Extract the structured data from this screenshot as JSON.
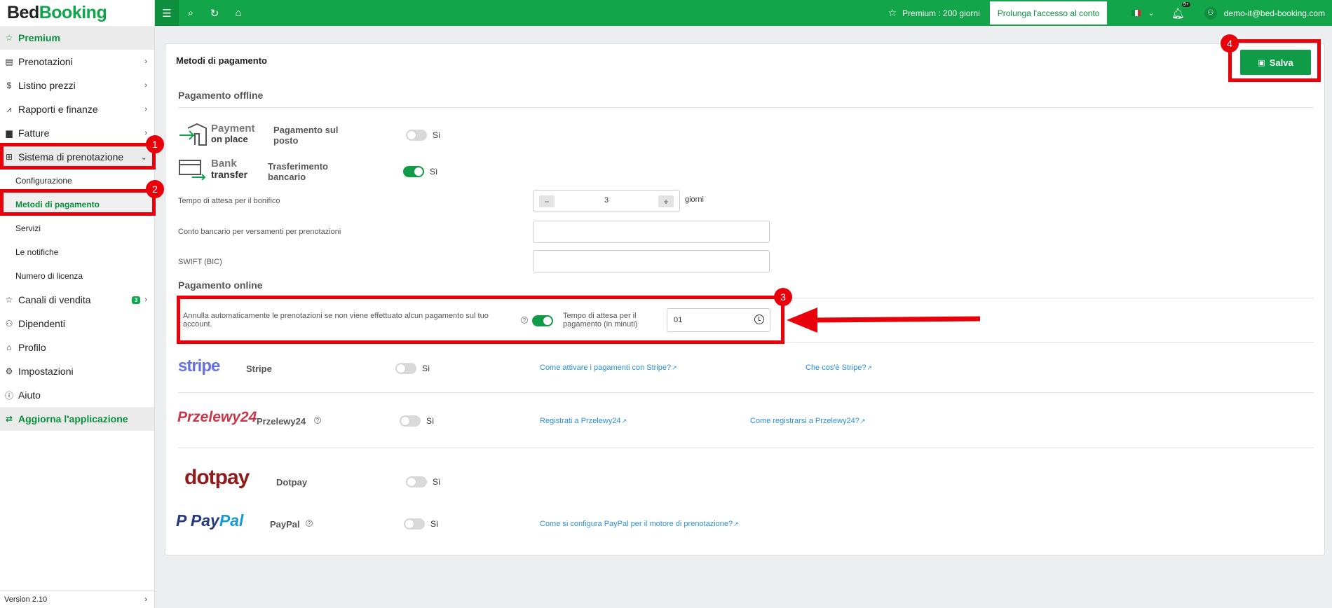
{
  "app": {
    "logo_part1": "Bed",
    "logo_part2": "Booking"
  },
  "sidebar": {
    "premium": "Premium",
    "items": [
      {
        "label": "Prenotazioni",
        "icon": "calendar-icon"
      },
      {
        "label": "Listino prezzi",
        "icon": "dollar-icon"
      },
      {
        "label": "Rapporti e finanze",
        "icon": "chart-icon"
      },
      {
        "label": "Fatture",
        "icon": "invoice-icon"
      },
      {
        "label": "Sistema di prenotazione",
        "icon": "grid-icon"
      }
    ],
    "sub_items": [
      "Configurazione",
      "Metodi di pagamento",
      "Servizi",
      "Le notifiche",
      "Numero di licenza"
    ],
    "items2": [
      {
        "label": "Canali di vendita",
        "icon": "star-icon",
        "badge": "3"
      },
      {
        "label": "Dipendenti",
        "icon": "users-icon"
      },
      {
        "label": "Profilo",
        "icon": "building-icon"
      },
      {
        "label": "Impostazioni",
        "icon": "gear-icon"
      },
      {
        "label": "Aiuto",
        "icon": "info-icon"
      }
    ],
    "update": "Aggiorna l'applicazione",
    "version": "Version 2.10"
  },
  "topbar": {
    "premium": "Premium : 200 giorni",
    "prolunga": "Prolunga l'accesso al conto",
    "notif_count": "9+",
    "user_email": "demo-it@bed-booking.com"
  },
  "page": {
    "title": "Metodi di pagamento",
    "save": "Salva",
    "offline_title": "Pagamento offline",
    "online_title": "Pagamento online",
    "yes": "Sì",
    "payment_on_place": {
      "logo_line1": "Payment",
      "logo_line2": "on place",
      "label": "Pagamento sul posto",
      "enabled": false
    },
    "bank_transfer": {
      "logo_line1": "Bank",
      "logo_line2": "transfer",
      "label": "Trasferimento bancario",
      "enabled": true
    },
    "wait_label": "Tempo di attesa per il bonifico",
    "wait_value": "3",
    "wait_unit": "giorni",
    "bank_account_label": "Conto bancario per versamenti per prenotazioni",
    "swift_label": "SWIFT (BIC)",
    "auto_cancel": "Annulla automaticamente le prenotazioni se non viene effettuato alcun pagamento sul tuo account.",
    "auto_cancel_enabled": true,
    "payment_wait_label": "Tempo di attesa per il pagamento (in minuti)",
    "payment_wait_value": "01",
    "stripe": {
      "logo": "stripe",
      "label": "Stripe",
      "link1": "Come attivare i pagamenti con Stripe?",
      "link2": "Che cos'è Stripe?",
      "enabled": false
    },
    "przelewy": {
      "logo": "Przelewy24",
      "label": "Przelewy24",
      "link1": "Registrati a Przelewy24",
      "link2": "Come registrarsi a Przelewy24?",
      "enabled": false
    },
    "dotpay": {
      "logo": "dotpay",
      "label": "Dotpay",
      "enabled": false
    },
    "paypal": {
      "logo_a": "Pay",
      "logo_b": "Pal",
      "label": "PayPal",
      "link1": "Come si configura PayPal per il motore di prenotazione?",
      "enabled": false
    }
  },
  "annotations": [
    "1",
    "2",
    "3",
    "4"
  ],
  "colors": {
    "brand_green": "#13a54a",
    "annotation_red": "#e8000b",
    "link_blue": "#2b8ed6"
  }
}
